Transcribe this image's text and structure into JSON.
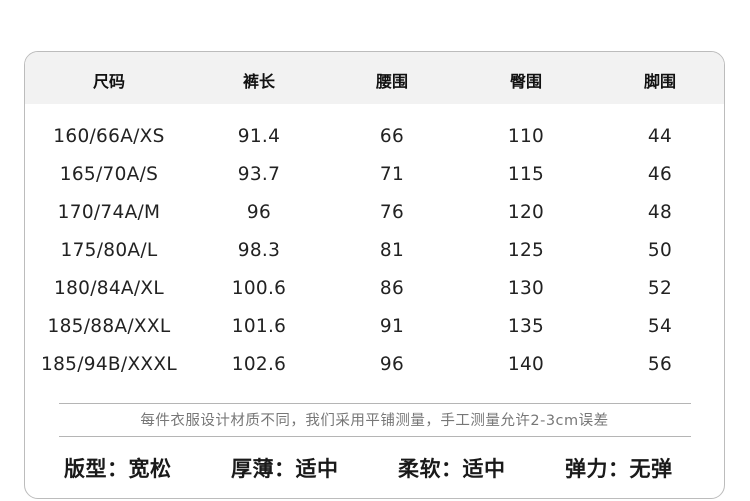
{
  "size_table": {
    "headers": [
      "尺码",
      "裤长",
      "腰围",
      "臀围",
      "脚围"
    ],
    "rows": [
      [
        "160/66A/XS",
        "91.4",
        "66",
        "110",
        "44"
      ],
      [
        "165/70A/S",
        "93.7",
        "71",
        "115",
        "46"
      ],
      [
        "170/74A/M",
        "96",
        "76",
        "120",
        "48"
      ],
      [
        "175/80A/L",
        "98.3",
        "81",
        "125",
        "50"
      ],
      [
        "180/84A/XL",
        "100.6",
        "86",
        "130",
        "52"
      ],
      [
        "185/88A/XXL",
        "101.6",
        "91",
        "135",
        "54"
      ],
      [
        "185/94B/XXXL",
        "102.6",
        "96",
        "140",
        "56"
      ]
    ]
  },
  "note": "每件衣服设计材质不同，我们采用平铺测量，手工测量允许2-3cm误差",
  "attributes": [
    {
      "label": "版型",
      "value": "宽松"
    },
    {
      "label": "厚薄",
      "value": "适中"
    },
    {
      "label": "柔软",
      "value": "适中"
    },
    {
      "label": "弹力",
      "value": "无弹"
    }
  ],
  "colors": {
    "header_bg": "#f2f2f2",
    "border": "#bcbcbc",
    "note_text": "#777777"
  }
}
